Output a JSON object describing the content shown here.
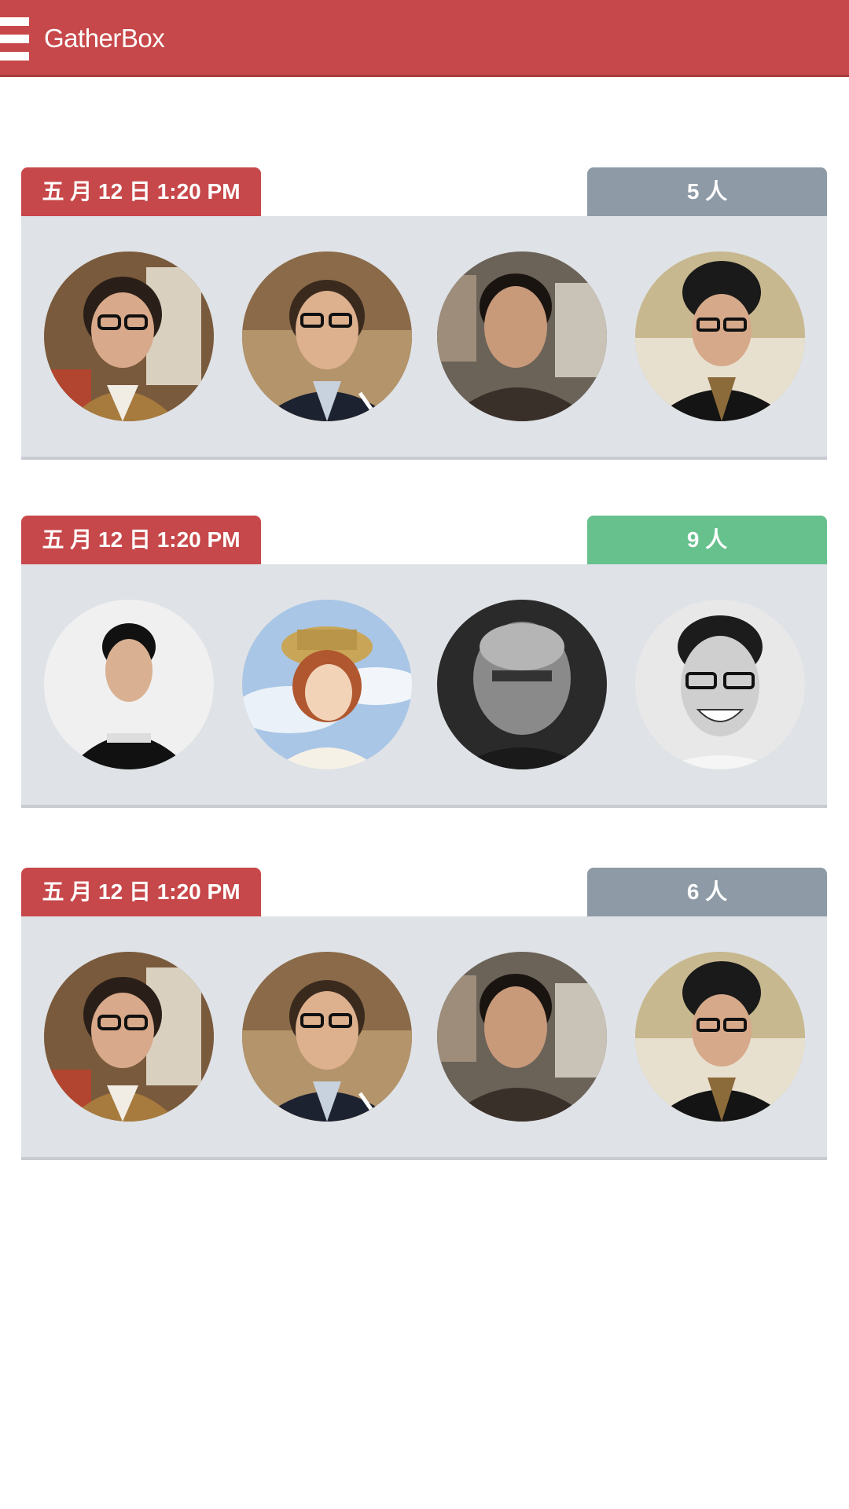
{
  "app": {
    "title": "GatherBox"
  },
  "colors": {
    "brand": "#c7484a",
    "count_gray": "#8e9ba6",
    "count_green": "#67c18d",
    "panel": "#dfe2e6"
  },
  "events": [
    {
      "date_label": "五 月 12 日  1:20 PM",
      "count_label": "5 人",
      "count_color": "gray",
      "avatars": [
        "avatar-glasses-plaid",
        "avatar-glasses-jacket",
        "avatar-man-jacket",
        "avatar-beanie-glasses"
      ]
    },
    {
      "date_label": "五 月 12 日  1:20 PM",
      "count_label": "9  人",
      "count_color": "green",
      "avatars": [
        "avatar-man-black-tee",
        "avatar-woman-straw-hat",
        "avatar-bald-man",
        "avatar-smiling-glasses"
      ]
    },
    {
      "date_label": "五 月 12 日  1:20 PM",
      "count_label": "6 人",
      "count_color": "gray",
      "avatars": [
        "avatar-glasses-plaid",
        "avatar-glasses-jacket",
        "avatar-man-jacket",
        "avatar-beanie-glasses"
      ]
    }
  ]
}
